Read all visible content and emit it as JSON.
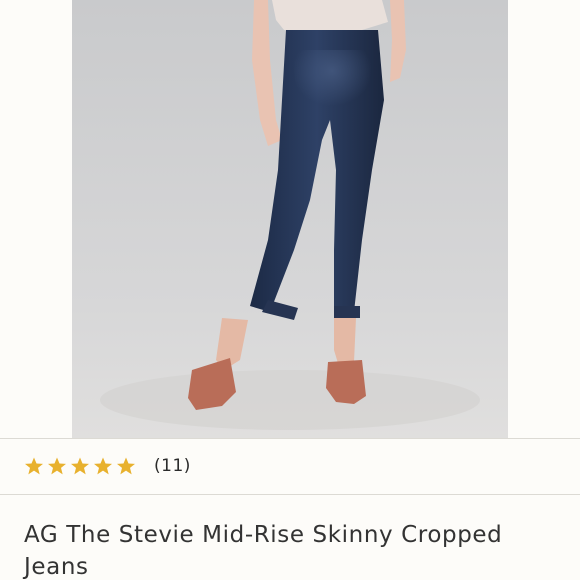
{
  "product": {
    "image_icon": "product-photo",
    "rating": {
      "stars": 5,
      "max_stars": 5,
      "review_count": "(11)",
      "star_color": "#e8b12e",
      "star_icon": "star-icon"
    },
    "title": "AG The Stevie Mid-Rise Skinny Cropped Jeans"
  },
  "colors": {
    "background": "#fdfcf9",
    "divider": "#dcdad4",
    "title_text": "#333333"
  }
}
